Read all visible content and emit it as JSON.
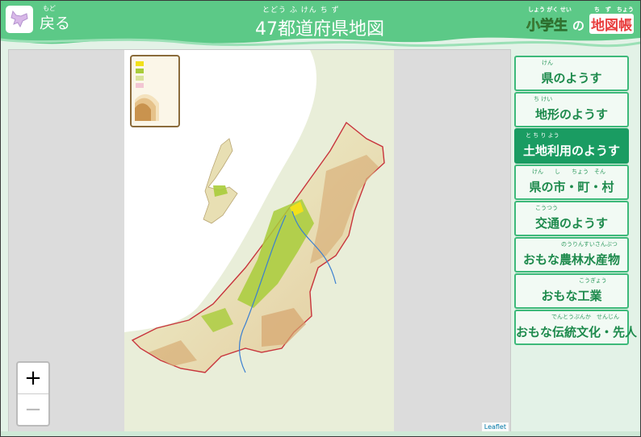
{
  "header": {
    "back_ruby": "もど",
    "back_label": "戻る",
    "title_ruby": "とどう ふ けん ち ず",
    "title": "47都道府県地図",
    "brand_ruby": "しょう がく せい　　　　ち　ず　ちょう",
    "brand_part1": "小学生",
    "brand_no": "の",
    "brand_part2": "地図帳"
  },
  "map": {
    "zoom_in": "+",
    "zoom_out": "−",
    "attribution": "Leaflet"
  },
  "menu": [
    {
      "label": "県のようす",
      "ruby": "けん",
      "active": false
    },
    {
      "label": "地形のようす",
      "ruby": "ち けい",
      "active": false
    },
    {
      "label": "土地利用のようす",
      "ruby": "と ち り よう",
      "active": true
    },
    {
      "label": "県の市・町・村",
      "ruby": "けん　　し　　ちょう　そん",
      "active": false
    },
    {
      "label": "交通のようす",
      "ruby": "こうつう",
      "active": false
    },
    {
      "label": "おもな農林水産物",
      "ruby": "のうりんすいさんぶつ",
      "active": false
    },
    {
      "label": "おもな工業",
      "ruby": "こうぎょう",
      "active": false
    },
    {
      "label": "おもな伝統文化・先人",
      "ruby": "でんとうぶんか　せんじん",
      "active": false
    }
  ],
  "colors": {
    "header_green": "#5cc987",
    "active_button": "#1a9c62",
    "button_border": "#3db97a",
    "button_text": "#1d8a4c"
  }
}
